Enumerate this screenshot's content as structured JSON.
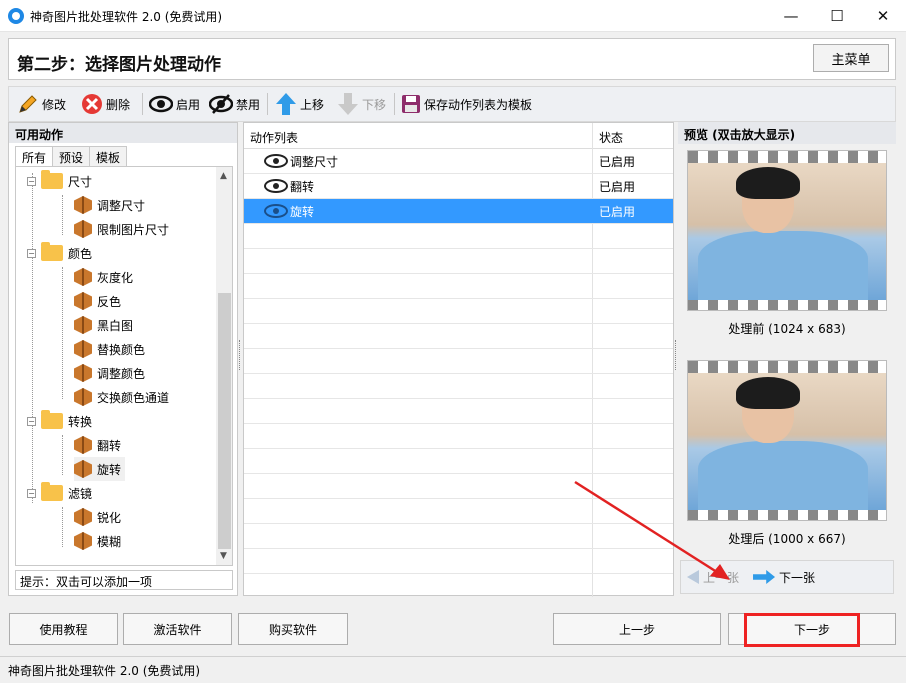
{
  "window": {
    "title": "神奇图片批处理软件 2.0 (免费试用)",
    "minimize": "—",
    "maximize": "☐",
    "close": "✕"
  },
  "step": {
    "title": "第二步：选择图片处理动作",
    "main_menu": "主菜单"
  },
  "toolbar": {
    "edit": "修改",
    "delete": "删除",
    "enable": "启用",
    "disable": "禁用",
    "move_up": "上移",
    "move_down": "下移",
    "save_template": "保存动作列表为模板"
  },
  "left_panel": {
    "title": "可用动作",
    "tabs": [
      "所有",
      "预设",
      "模板"
    ],
    "tree": [
      {
        "label": "尺寸",
        "type": "folder",
        "children": [
          "调整尺寸",
          "限制图片尺寸"
        ]
      },
      {
        "label": "颜色",
        "type": "folder",
        "children": [
          "灰度化",
          "反色",
          "黑白图",
          "替换颜色",
          "调整颜色",
          "交换颜色通道"
        ]
      },
      {
        "label": "转换",
        "type": "folder",
        "children": [
          "翻转",
          "旋转"
        ]
      },
      {
        "label": "滤镜",
        "type": "folder",
        "children": [
          "锐化",
          "模糊"
        ]
      }
    ],
    "hint": "提示：双击可以添加一项"
  },
  "action_list": {
    "col_name": "动作列表",
    "col_status": "状态",
    "rows": [
      {
        "name": "调整尺寸",
        "status": "已启用",
        "selected": false
      },
      {
        "name": "翻转",
        "status": "已启用",
        "selected": false
      },
      {
        "name": "旋转",
        "status": "已启用",
        "selected": true
      }
    ]
  },
  "preview": {
    "title": "预览 (双击放大显示)",
    "before": "处理前 (1024 x 683)",
    "after": "处理后 (1000 x 667)",
    "prev": "上一张",
    "next": "下一张"
  },
  "bottom": {
    "tutorial": "使用教程",
    "activate": "激活软件",
    "buy": "购买软件",
    "prev_step": "上一步",
    "next_step": "下一步"
  },
  "statusbar": {
    "text": "神奇图片批处理软件 2.0 (免费试用)"
  },
  "colors": {
    "selection": "#3399ff",
    "annotation": "#e22222",
    "accent": "#2f9be8"
  }
}
